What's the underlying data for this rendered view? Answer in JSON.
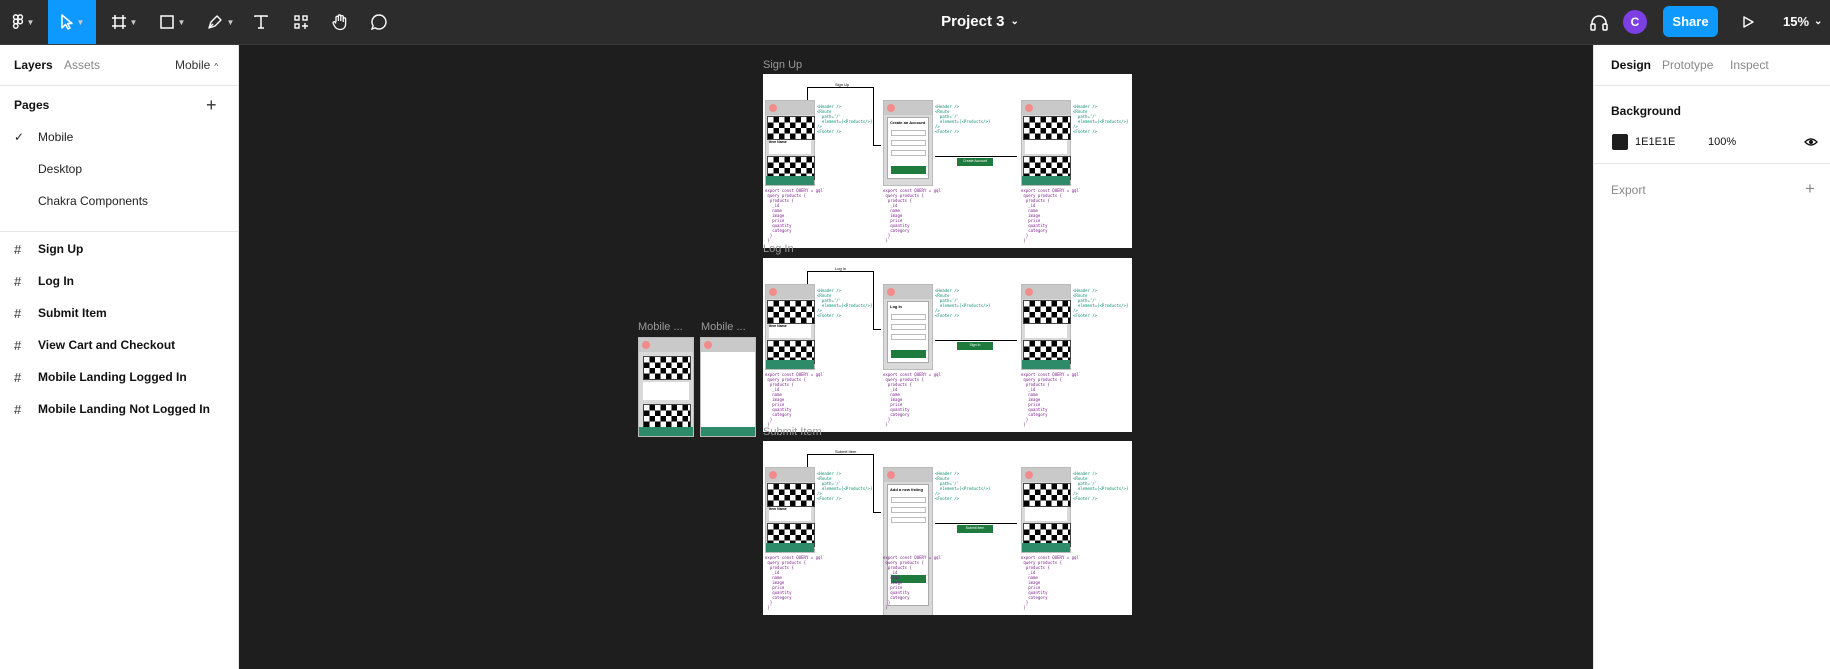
{
  "project": {
    "title": "Project 3"
  },
  "toolbar": {
    "avatar": "C",
    "share": "Share",
    "zoom": "15%"
  },
  "left": {
    "tabs": [
      "Layers",
      "Assets"
    ],
    "page_select": "Mobile",
    "pages_title": "Pages",
    "pages": [
      "Mobile",
      "Desktop",
      "Chakra Components"
    ],
    "layers": [
      "Sign Up",
      "Log In",
      "Submit Item",
      "View Cart and Checkout",
      "Mobile Landing Logged In",
      "Mobile Landing Not Logged In"
    ]
  },
  "right": {
    "tabs": [
      "Design",
      "Prototype",
      "Inspect"
    ],
    "background_title": "Background",
    "bg_hex": "1E1E1E",
    "bg_opacity": "100%",
    "export_title": "Export"
  },
  "canvas": {
    "frames": [
      "Sign Up",
      "Log In",
      "Submit Item"
    ],
    "mobile_labels": [
      "Mobile ...",
      "Mobile ..."
    ],
    "flow_labels": [
      "Sign Up",
      "Log In",
      "Submit Item"
    ],
    "form_titles": [
      "Create an Account",
      "Log In",
      "Add a new listing"
    ],
    "button_labels": [
      "Create Account",
      "Sign In",
      "Submit Item"
    ],
    "card_title": "Item Name"
  },
  "colors": {
    "accent": "#0d99ff",
    "avatar": "#7b3fe4",
    "canvas": "#1e1e1e",
    "green": "#1f7a3d"
  }
}
